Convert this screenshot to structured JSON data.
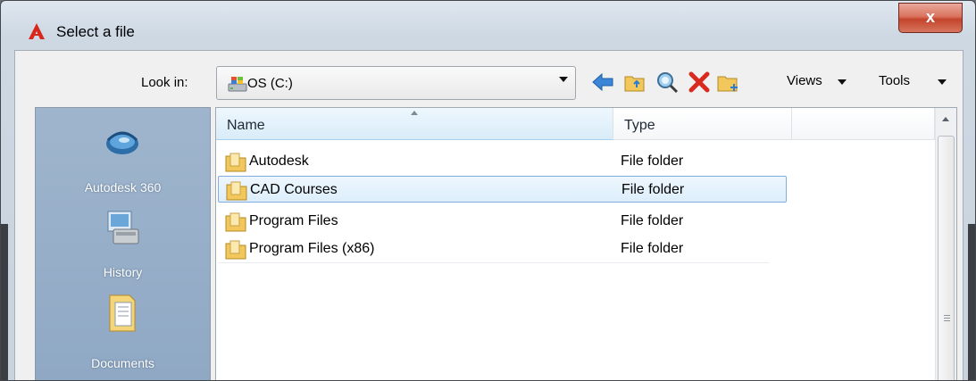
{
  "window": {
    "title": "Select a file",
    "close_glyph": "x"
  },
  "lookin": {
    "label": "Look in:",
    "value": "OS (C:)"
  },
  "toolbar": {
    "views_label": "Views",
    "tools_label": "Tools",
    "icons": [
      "back-arrow-icon",
      "up-folder-icon",
      "search-web-icon",
      "delete-icon",
      "new-folder-icon"
    ]
  },
  "places": {
    "items": [
      {
        "label": "Autodesk 360",
        "icon": "autodesk-360-icon"
      },
      {
        "label": "History",
        "icon": "history-icon"
      },
      {
        "label": "Documents",
        "icon": "documents-icon"
      }
    ]
  },
  "filelist": {
    "columns": {
      "name": "Name",
      "type": "Type"
    },
    "rows": [
      {
        "name": "Autodesk",
        "type": "File folder",
        "selected": false
      },
      {
        "name": "CAD Courses",
        "type": "File folder",
        "selected": true
      },
      {
        "name": "Program Files",
        "type": "File folder",
        "selected": false
      },
      {
        "name": "Program Files (x86)",
        "type": "File folder",
        "selected": false
      }
    ]
  },
  "colors": {
    "accent_red": "#d8271c",
    "selection": "#dceefb",
    "places_panel": "#94abc7"
  }
}
